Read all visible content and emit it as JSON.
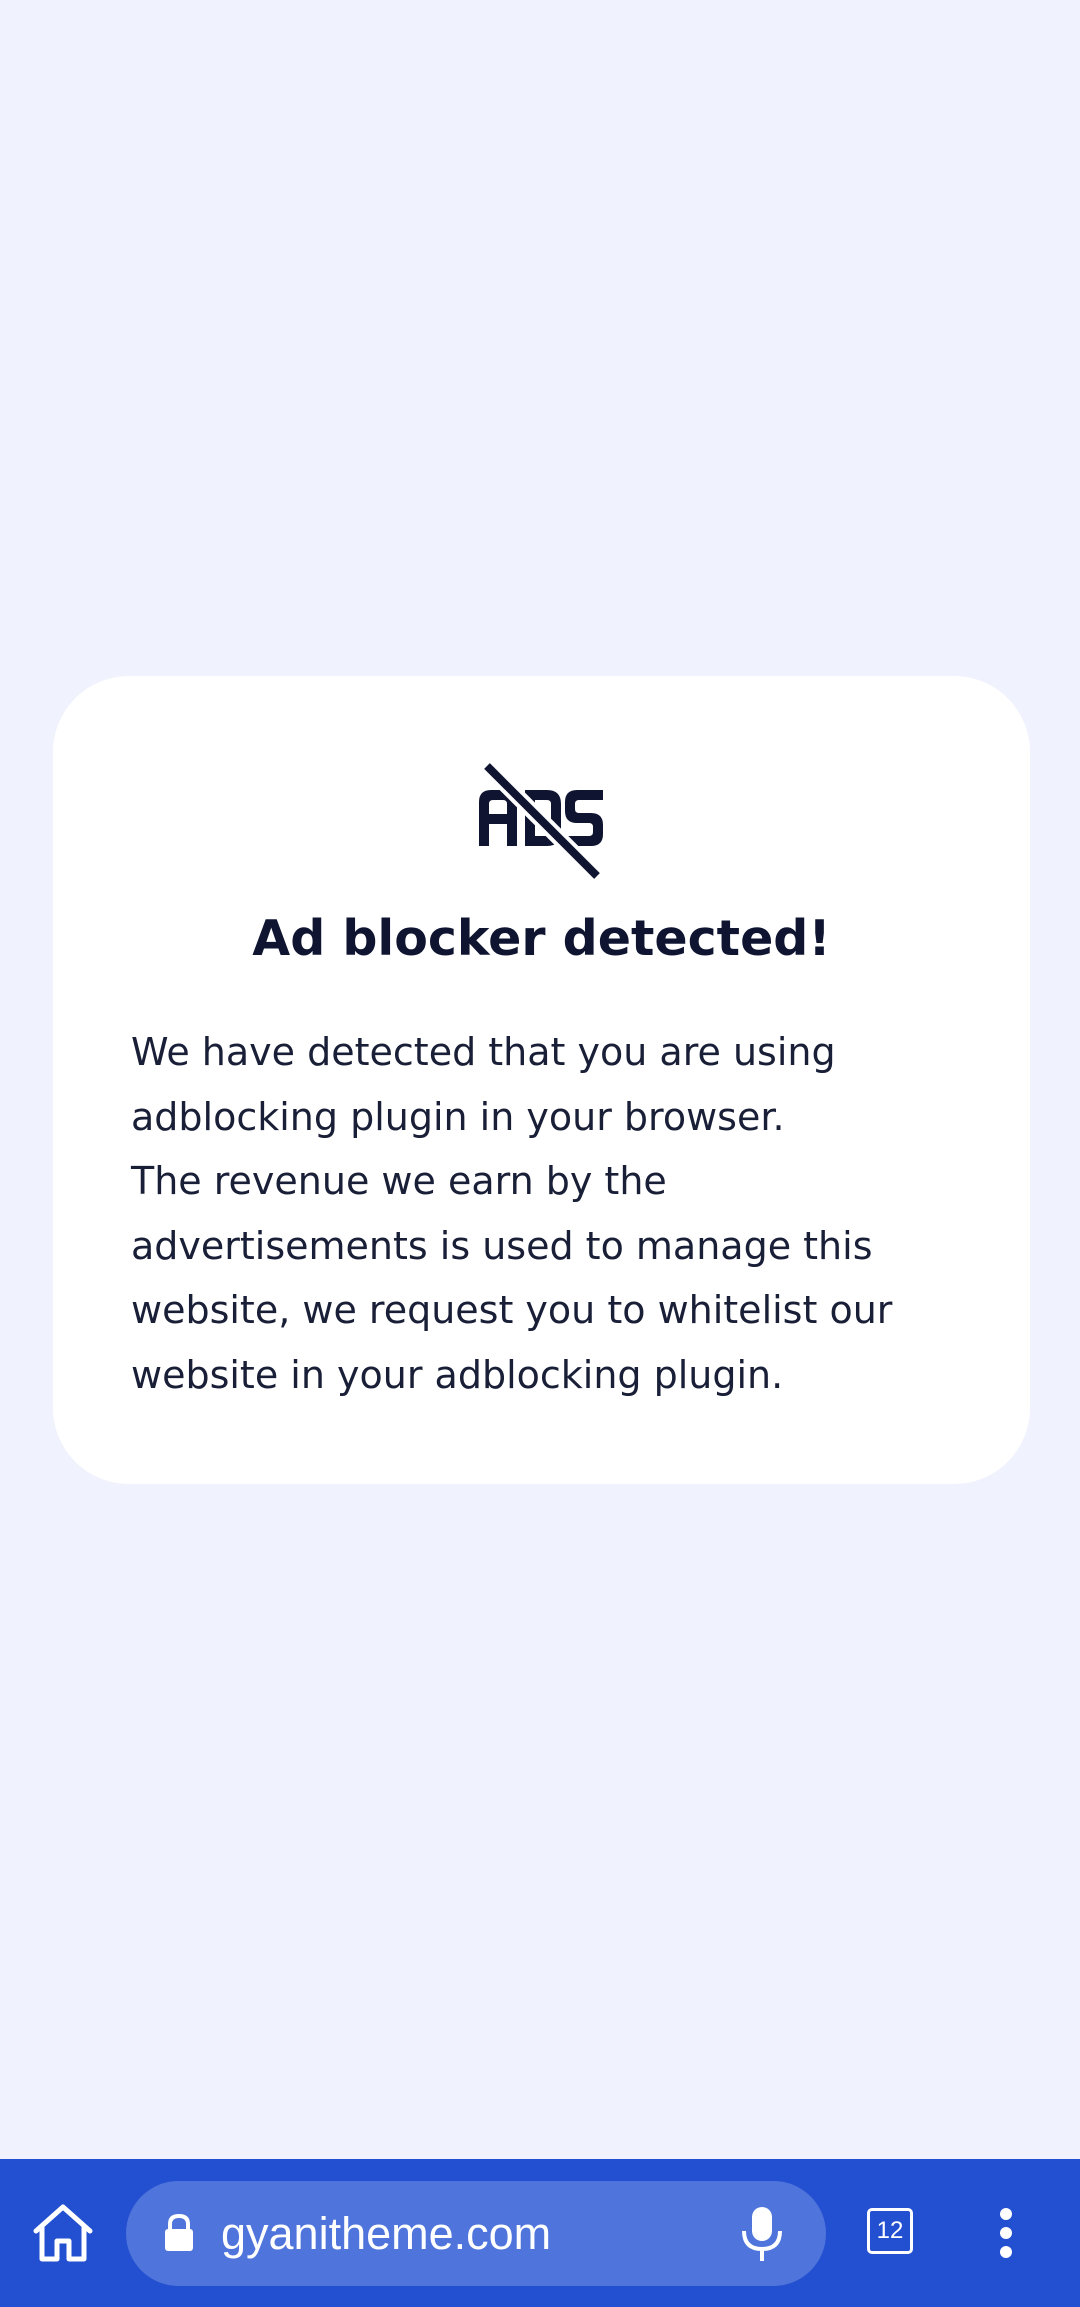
{
  "modal": {
    "icon": "ads-blocked-icon",
    "title": "Ad blocker detected!",
    "message_lines": [
      "We have detected that you are using adblocking plugin in your browser.",
      "The revenue we earn by the advertisements is used to manage this website, we request you to whitelist our website in your adblocking plugin."
    ]
  },
  "browser": {
    "url": "gyanitheme.com",
    "tab_count": "12",
    "icons": {
      "home": "home-icon",
      "lock": "lock-icon",
      "mic": "microphone-icon",
      "tabs": "tabs-icon",
      "menu": "more-vert-icon"
    }
  },
  "colors": {
    "page_background": "#f0f3fd",
    "card_background": "#ffffff",
    "text_dark": "#0f1531",
    "browser_bar": "#2350d0",
    "url_bar": "#4f74db"
  }
}
